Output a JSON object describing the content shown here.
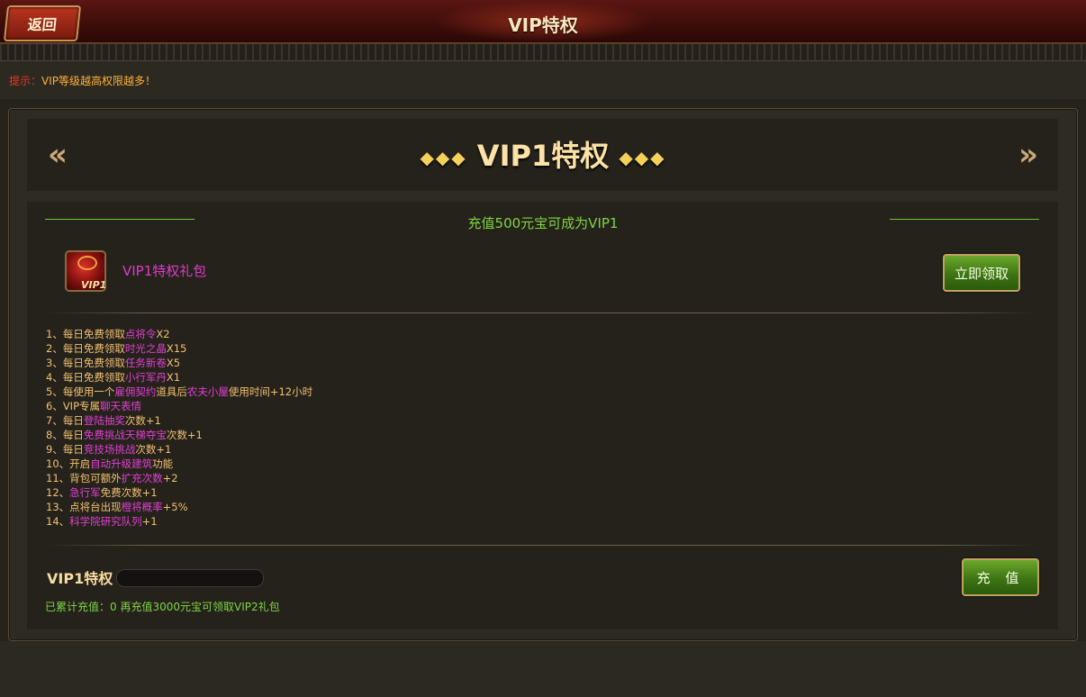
{
  "header": {
    "back_label": "返回",
    "title": "VIP特权"
  },
  "hint": {
    "prefix": "提示：",
    "text": "VIP等级越高权限越多！"
  },
  "vip_panel": {
    "heading": "VIP1特权",
    "recharge_requirement": "充值500元宝可成为VIP1",
    "gift": {
      "icon_text": "VIP1",
      "name": "VIP1特权礼包",
      "claim_label": "立即领取"
    },
    "perks": [
      {
        "parts": [
          {
            "t": "1、每日免费领取"
          },
          {
            "t": "点将令",
            "hl": true
          },
          {
            "t": "X2"
          }
        ]
      },
      {
        "parts": [
          {
            "t": "2、每日免费领取"
          },
          {
            "t": "时光之晶",
            "hl": true
          },
          {
            "t": "X15"
          }
        ]
      },
      {
        "parts": [
          {
            "t": "3、每日免费领取"
          },
          {
            "t": "任务新卷",
            "hl": true
          },
          {
            "t": "X5"
          }
        ]
      },
      {
        "parts": [
          {
            "t": "4、每日免费领取"
          },
          {
            "t": "小行军丹",
            "hl": true
          },
          {
            "t": "X1"
          }
        ]
      },
      {
        "parts": [
          {
            "t": "5、每使用一个"
          },
          {
            "t": "雇佣契约",
            "hl": true
          },
          {
            "t": "道具后"
          },
          {
            "t": "农夫小屋",
            "hl": true
          },
          {
            "t": "使用时间+12小时"
          }
        ]
      },
      {
        "parts": [
          {
            "t": "6、VIP专属"
          },
          {
            "t": "聊天表情",
            "hl": true
          }
        ]
      },
      {
        "parts": [
          {
            "t": "7、每日"
          },
          {
            "t": "登陆抽奖",
            "hl": true
          },
          {
            "t": "次数+1"
          }
        ]
      },
      {
        "parts": [
          {
            "t": "8、每日"
          },
          {
            "t": "免费挑战天梯夺宝",
            "hl": true
          },
          {
            "t": "次数+1"
          }
        ]
      },
      {
        "parts": [
          {
            "t": "9、每日"
          },
          {
            "t": "竞技场挑战",
            "hl": true
          },
          {
            "t": "次数+1"
          }
        ]
      },
      {
        "parts": [
          {
            "t": "10、开启"
          },
          {
            "t": "自动升级建筑",
            "hl": true
          },
          {
            "t": "功能"
          }
        ]
      },
      {
        "parts": [
          {
            "t": "11、背包可额外"
          },
          {
            "t": "扩充次数",
            "hl": true
          },
          {
            "t": "+2"
          }
        ]
      },
      {
        "parts": [
          {
            "t": "12、"
          },
          {
            "t": "急行军",
            "hl": true
          },
          {
            "t": "免费次数+1"
          }
        ]
      },
      {
        "parts": [
          {
            "t": "13、点将台出现"
          },
          {
            "t": "橙将概率",
            "hl": true
          },
          {
            "t": "+5%"
          }
        ]
      },
      {
        "parts": [
          {
            "t": "14、"
          },
          {
            "t": "科学院研究队列",
            "hl": true
          },
          {
            "t": "+1"
          }
        ]
      }
    ],
    "current_label": "VIP1特权",
    "progress_fraction": 0,
    "cumulative_text": "已累计充值：0 再充值3000元宝可领取VIP2礼包",
    "topup_label": "充 值"
  },
  "colors": {
    "highlight": "#e040d0",
    "perk_text": "#f0c070",
    "green_text": "#7ed640",
    "hint_prefix": "#e8352c"
  },
  "icons": {
    "prev": "chevron-left-icon",
    "next": "chevron-right-icon",
    "gift": "gift-box-icon"
  }
}
